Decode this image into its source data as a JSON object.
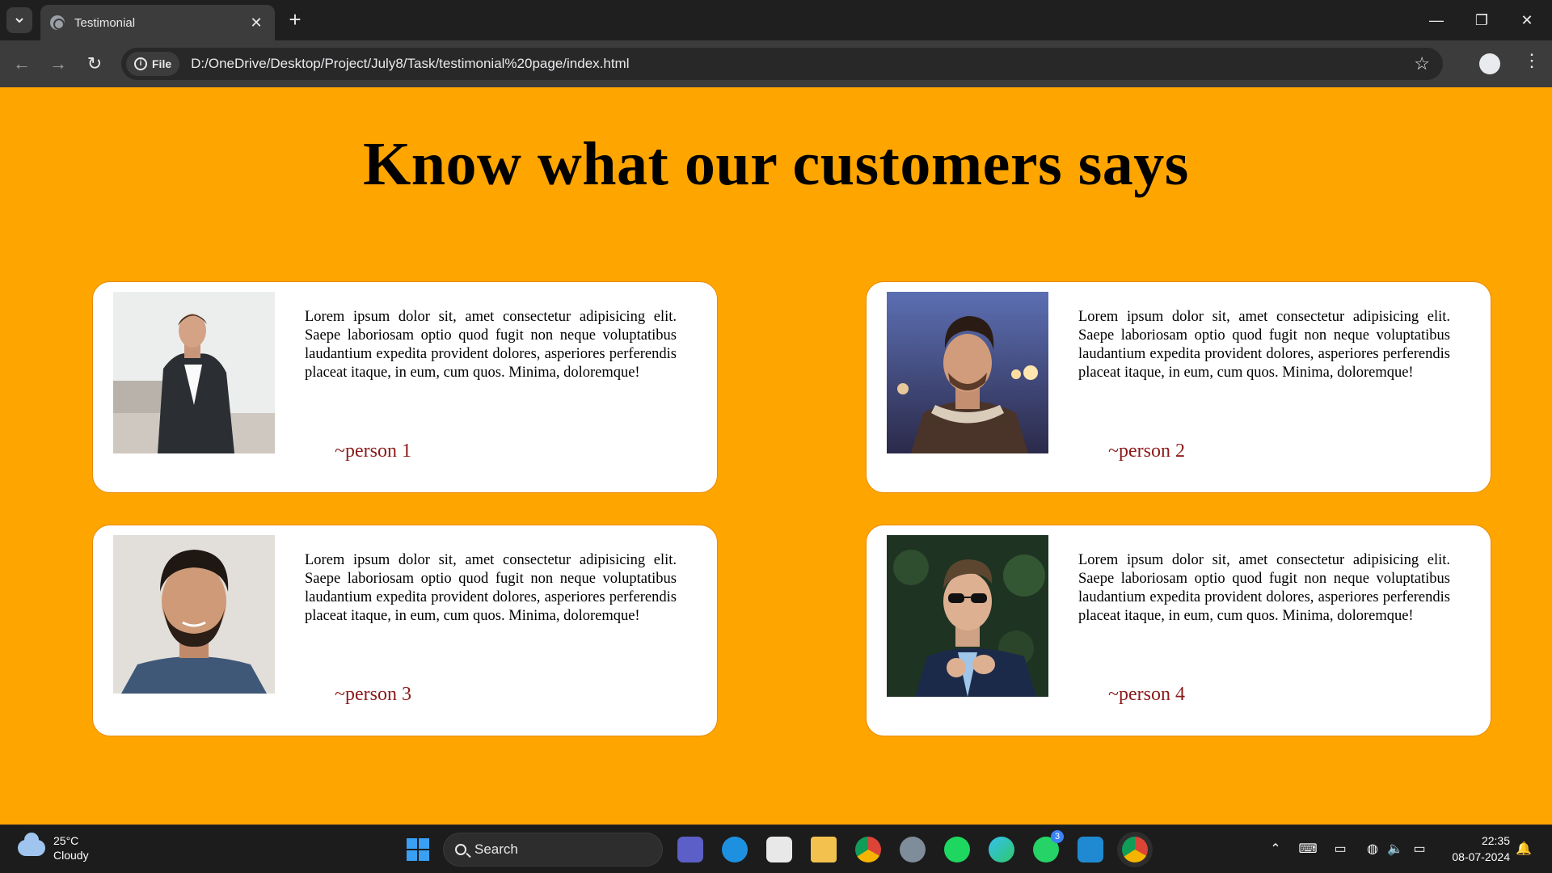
{
  "browser": {
    "tab_title": "Testimonial",
    "chip_label": "File",
    "url": "D:/OneDrive/Desktop/Project/July8/Task/testimonial%20page/index.html"
  },
  "page": {
    "heading": "Know what our customers says",
    "background": "#ffa500",
    "testimonials": [
      {
        "text": "Lorem ipsum dolor sit, amet consectetur adipisicing elit. Saepe laboriosam optio quod fugit non neque voluptatibus laudantium expedita provident dolores, asperiores perferendis placeat itaque, in eum, cum quos. Minima, doloremque!",
        "author": "~person 1"
      },
      {
        "text": "Lorem ipsum dolor sit, amet consectetur adipisicing elit. Saepe laboriosam optio quod fugit non neque voluptatibus laudantium expedita provident dolores, asperiores perferendis placeat itaque, in eum, cum quos. Minima, doloremque!",
        "author": "~person 2"
      },
      {
        "text": "Lorem ipsum dolor sit, amet consectetur adipisicing elit. Saepe laboriosam optio quod fugit non neque voluptatibus laudantium expedita provident dolores, asperiores perferendis placeat itaque, in eum, cum quos. Minima, doloremque!",
        "author": "~person 3"
      },
      {
        "text": "Lorem ipsum dolor sit, amet consectetur adipisicing elit. Saepe laboriosam optio quod fugit non neque voluptatibus laudantium expedita provident dolores, asperiores perferendis placeat itaque, in eum, cum quos. Minima, doloremque!",
        "author": "~person 4"
      }
    ]
  },
  "taskbar": {
    "weather_temp": "25°C",
    "weather_desc": "Cloudy",
    "search_label": "Search",
    "whatsapp_badge": "3",
    "time": "22:35",
    "date": "08-07-2024"
  }
}
